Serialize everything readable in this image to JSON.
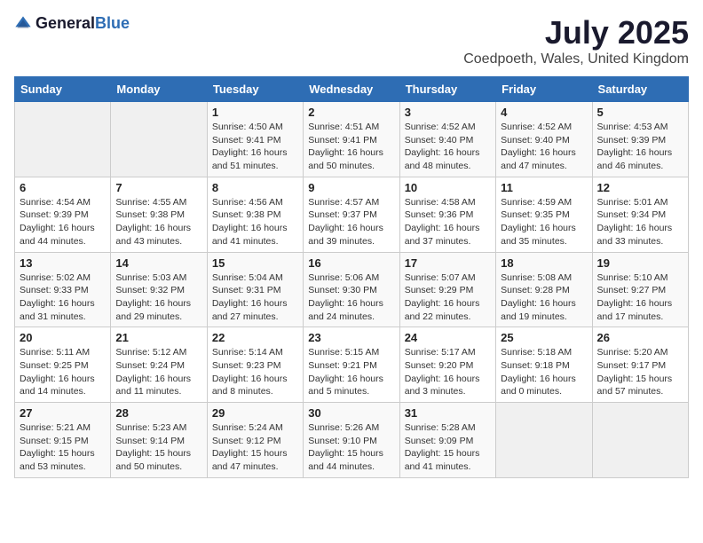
{
  "logo": {
    "text_general": "General",
    "text_blue": "Blue"
  },
  "title": "July 2025",
  "subtitle": "Coedpoeth, Wales, United Kingdom",
  "days_of_week": [
    "Sunday",
    "Monday",
    "Tuesday",
    "Wednesday",
    "Thursday",
    "Friday",
    "Saturday"
  ],
  "weeks": [
    [
      {
        "day": "",
        "sunrise": "",
        "sunset": "",
        "daylight": ""
      },
      {
        "day": "",
        "sunrise": "",
        "sunset": "",
        "daylight": ""
      },
      {
        "day": "1",
        "sunrise": "Sunrise: 4:50 AM",
        "sunset": "Sunset: 9:41 PM",
        "daylight": "Daylight: 16 hours and 51 minutes."
      },
      {
        "day": "2",
        "sunrise": "Sunrise: 4:51 AM",
        "sunset": "Sunset: 9:41 PM",
        "daylight": "Daylight: 16 hours and 50 minutes."
      },
      {
        "day": "3",
        "sunrise": "Sunrise: 4:52 AM",
        "sunset": "Sunset: 9:40 PM",
        "daylight": "Daylight: 16 hours and 48 minutes."
      },
      {
        "day": "4",
        "sunrise": "Sunrise: 4:52 AM",
        "sunset": "Sunset: 9:40 PM",
        "daylight": "Daylight: 16 hours and 47 minutes."
      },
      {
        "day": "5",
        "sunrise": "Sunrise: 4:53 AM",
        "sunset": "Sunset: 9:39 PM",
        "daylight": "Daylight: 16 hours and 46 minutes."
      }
    ],
    [
      {
        "day": "6",
        "sunrise": "Sunrise: 4:54 AM",
        "sunset": "Sunset: 9:39 PM",
        "daylight": "Daylight: 16 hours and 44 minutes."
      },
      {
        "day": "7",
        "sunrise": "Sunrise: 4:55 AM",
        "sunset": "Sunset: 9:38 PM",
        "daylight": "Daylight: 16 hours and 43 minutes."
      },
      {
        "day": "8",
        "sunrise": "Sunrise: 4:56 AM",
        "sunset": "Sunset: 9:38 PM",
        "daylight": "Daylight: 16 hours and 41 minutes."
      },
      {
        "day": "9",
        "sunrise": "Sunrise: 4:57 AM",
        "sunset": "Sunset: 9:37 PM",
        "daylight": "Daylight: 16 hours and 39 minutes."
      },
      {
        "day": "10",
        "sunrise": "Sunrise: 4:58 AM",
        "sunset": "Sunset: 9:36 PM",
        "daylight": "Daylight: 16 hours and 37 minutes."
      },
      {
        "day": "11",
        "sunrise": "Sunrise: 4:59 AM",
        "sunset": "Sunset: 9:35 PM",
        "daylight": "Daylight: 16 hours and 35 minutes."
      },
      {
        "day": "12",
        "sunrise": "Sunrise: 5:01 AM",
        "sunset": "Sunset: 9:34 PM",
        "daylight": "Daylight: 16 hours and 33 minutes."
      }
    ],
    [
      {
        "day": "13",
        "sunrise": "Sunrise: 5:02 AM",
        "sunset": "Sunset: 9:33 PM",
        "daylight": "Daylight: 16 hours and 31 minutes."
      },
      {
        "day": "14",
        "sunrise": "Sunrise: 5:03 AM",
        "sunset": "Sunset: 9:32 PM",
        "daylight": "Daylight: 16 hours and 29 minutes."
      },
      {
        "day": "15",
        "sunrise": "Sunrise: 5:04 AM",
        "sunset": "Sunset: 9:31 PM",
        "daylight": "Daylight: 16 hours and 27 minutes."
      },
      {
        "day": "16",
        "sunrise": "Sunrise: 5:06 AM",
        "sunset": "Sunset: 9:30 PM",
        "daylight": "Daylight: 16 hours and 24 minutes."
      },
      {
        "day": "17",
        "sunrise": "Sunrise: 5:07 AM",
        "sunset": "Sunset: 9:29 PM",
        "daylight": "Daylight: 16 hours and 22 minutes."
      },
      {
        "day": "18",
        "sunrise": "Sunrise: 5:08 AM",
        "sunset": "Sunset: 9:28 PM",
        "daylight": "Daylight: 16 hours and 19 minutes."
      },
      {
        "day": "19",
        "sunrise": "Sunrise: 5:10 AM",
        "sunset": "Sunset: 9:27 PM",
        "daylight": "Daylight: 16 hours and 17 minutes."
      }
    ],
    [
      {
        "day": "20",
        "sunrise": "Sunrise: 5:11 AM",
        "sunset": "Sunset: 9:25 PM",
        "daylight": "Daylight: 16 hours and 14 minutes."
      },
      {
        "day": "21",
        "sunrise": "Sunrise: 5:12 AM",
        "sunset": "Sunset: 9:24 PM",
        "daylight": "Daylight: 16 hours and 11 minutes."
      },
      {
        "day": "22",
        "sunrise": "Sunrise: 5:14 AM",
        "sunset": "Sunset: 9:23 PM",
        "daylight": "Daylight: 16 hours and 8 minutes."
      },
      {
        "day": "23",
        "sunrise": "Sunrise: 5:15 AM",
        "sunset": "Sunset: 9:21 PM",
        "daylight": "Daylight: 16 hours and 5 minutes."
      },
      {
        "day": "24",
        "sunrise": "Sunrise: 5:17 AM",
        "sunset": "Sunset: 9:20 PM",
        "daylight": "Daylight: 16 hours and 3 minutes."
      },
      {
        "day": "25",
        "sunrise": "Sunrise: 5:18 AM",
        "sunset": "Sunset: 9:18 PM",
        "daylight": "Daylight: 16 hours and 0 minutes."
      },
      {
        "day": "26",
        "sunrise": "Sunrise: 5:20 AM",
        "sunset": "Sunset: 9:17 PM",
        "daylight": "Daylight: 15 hours and 57 minutes."
      }
    ],
    [
      {
        "day": "27",
        "sunrise": "Sunrise: 5:21 AM",
        "sunset": "Sunset: 9:15 PM",
        "daylight": "Daylight: 15 hours and 53 minutes."
      },
      {
        "day": "28",
        "sunrise": "Sunrise: 5:23 AM",
        "sunset": "Sunset: 9:14 PM",
        "daylight": "Daylight: 15 hours and 50 minutes."
      },
      {
        "day": "29",
        "sunrise": "Sunrise: 5:24 AM",
        "sunset": "Sunset: 9:12 PM",
        "daylight": "Daylight: 15 hours and 47 minutes."
      },
      {
        "day": "30",
        "sunrise": "Sunrise: 5:26 AM",
        "sunset": "Sunset: 9:10 PM",
        "daylight": "Daylight: 15 hours and 44 minutes."
      },
      {
        "day": "31",
        "sunrise": "Sunrise: 5:28 AM",
        "sunset": "Sunset: 9:09 PM",
        "daylight": "Daylight: 15 hours and 41 minutes."
      },
      {
        "day": "",
        "sunrise": "",
        "sunset": "",
        "daylight": ""
      },
      {
        "day": "",
        "sunrise": "",
        "sunset": "",
        "daylight": ""
      }
    ]
  ]
}
